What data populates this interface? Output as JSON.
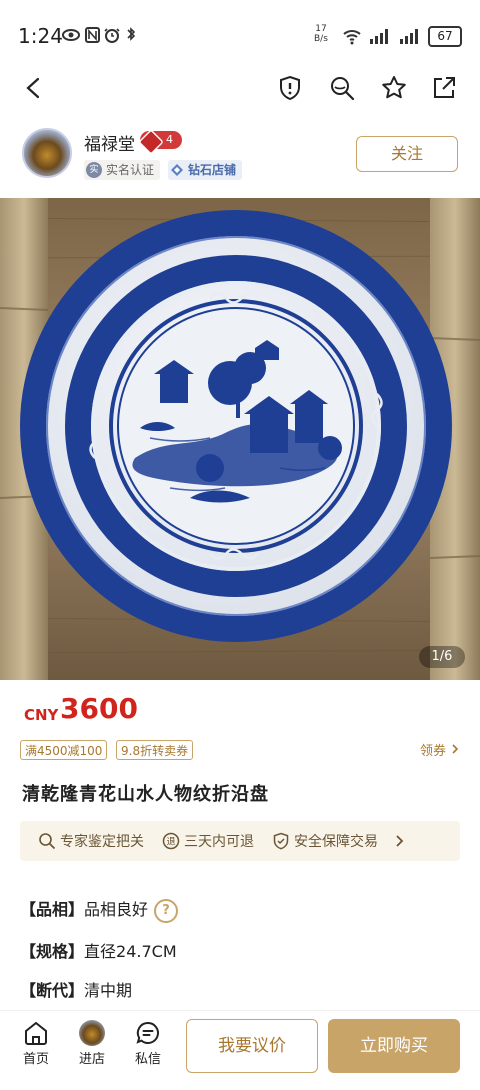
{
  "status_bar": {
    "time": "1:24",
    "net_speed_value": "17",
    "net_speed_unit": "B/s",
    "battery": "67"
  },
  "shop": {
    "name": "福禄堂",
    "level": "4",
    "verified_label": "实名认证",
    "verified_icon_text": "实",
    "store_tier_label": "钻石店铺",
    "follow_label": "关注"
  },
  "gallery": {
    "indicator": "1/6"
  },
  "price": {
    "currency": "CNY",
    "amount": "3600"
  },
  "coupons": [
    {
      "label": "满4500减100"
    },
    {
      "label": "9.8折转卖券"
    }
  ],
  "coupon_link": "领券",
  "product": {
    "title": "清乾隆青花山水人物纹折沿盘"
  },
  "services": [
    {
      "label": "专家鉴定把关",
      "icon": "search-icon"
    },
    {
      "label": "三天内可退",
      "icon": "return-icon"
    },
    {
      "label": "安全保障交易",
      "icon": "shield-check-icon"
    }
  ],
  "attributes": [
    {
      "key": "【品相】",
      "value": "品相良好"
    },
    {
      "key": "【规格】",
      "value": "直径24.7CM"
    },
    {
      "key": "【断代】",
      "value": "清中期"
    }
  ],
  "attribute_help": "?",
  "bottom_nav": {
    "home": "首页",
    "shop": "进店",
    "message": "私信",
    "offer_label": "我要议价",
    "buy_label": "立即购买"
  },
  "colors": {
    "accent_gold": "#c9a468",
    "price_red": "#d0241c",
    "porcelain_blue": "#1f3f95"
  }
}
